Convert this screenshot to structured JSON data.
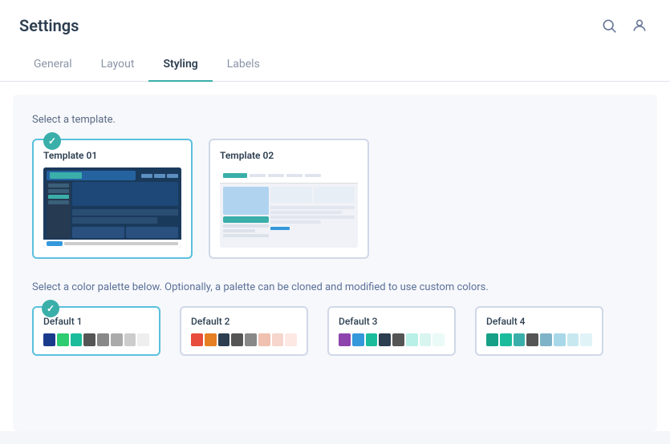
{
  "page": {
    "title": "Settings"
  },
  "header": {
    "icons": [
      "search-icon",
      "user-icon"
    ]
  },
  "tabs": {
    "items": [
      {
        "id": "general",
        "label": "General",
        "active": false
      },
      {
        "id": "layout",
        "label": "Layout",
        "active": false
      },
      {
        "id": "styling",
        "label": "Styling",
        "active": true
      },
      {
        "id": "labels",
        "label": "Labels",
        "active": false
      }
    ]
  },
  "content": {
    "template_section_label": "Select a template.",
    "templates": [
      {
        "id": "t01",
        "name": "Template 01",
        "selected": true
      },
      {
        "id": "t02",
        "name": "Template 02",
        "selected": false
      }
    ],
    "color_section_label": "Select a color palette below. Optionally, a palette can be cloned and modified to use custom colors.",
    "palettes": [
      {
        "id": "default1",
        "name": "Default 1",
        "selected": true,
        "swatches": [
          "#1a3a8c",
          "#2dcc70",
          "#1abc9c",
          "#555",
          "#888",
          "#aaa",
          "#ccc",
          "#eee"
        ]
      },
      {
        "id": "default2",
        "name": "Default 2",
        "selected": false,
        "swatches": [
          "#e74c3c",
          "#e67e22",
          "#2c3e50",
          "#555",
          "#888",
          "#f0c0b0",
          "#f5d5cc",
          "#fde8e4"
        ]
      },
      {
        "id": "default3",
        "name": "Default 3",
        "selected": false,
        "swatches": [
          "#8e44ad",
          "#3498db",
          "#1abc9c",
          "#2c3e50",
          "#555",
          "#b8f0e8",
          "#d8f5f0",
          "#eafaf7"
        ]
      },
      {
        "id": "default4",
        "name": "Default 4",
        "selected": false,
        "swatches": [
          "#16a085",
          "#1abc9c",
          "#3aafa9",
          "#555",
          "#7fb3c8",
          "#a8d8e8",
          "#c8e8f0",
          "#e0f4f8"
        ]
      }
    ]
  }
}
